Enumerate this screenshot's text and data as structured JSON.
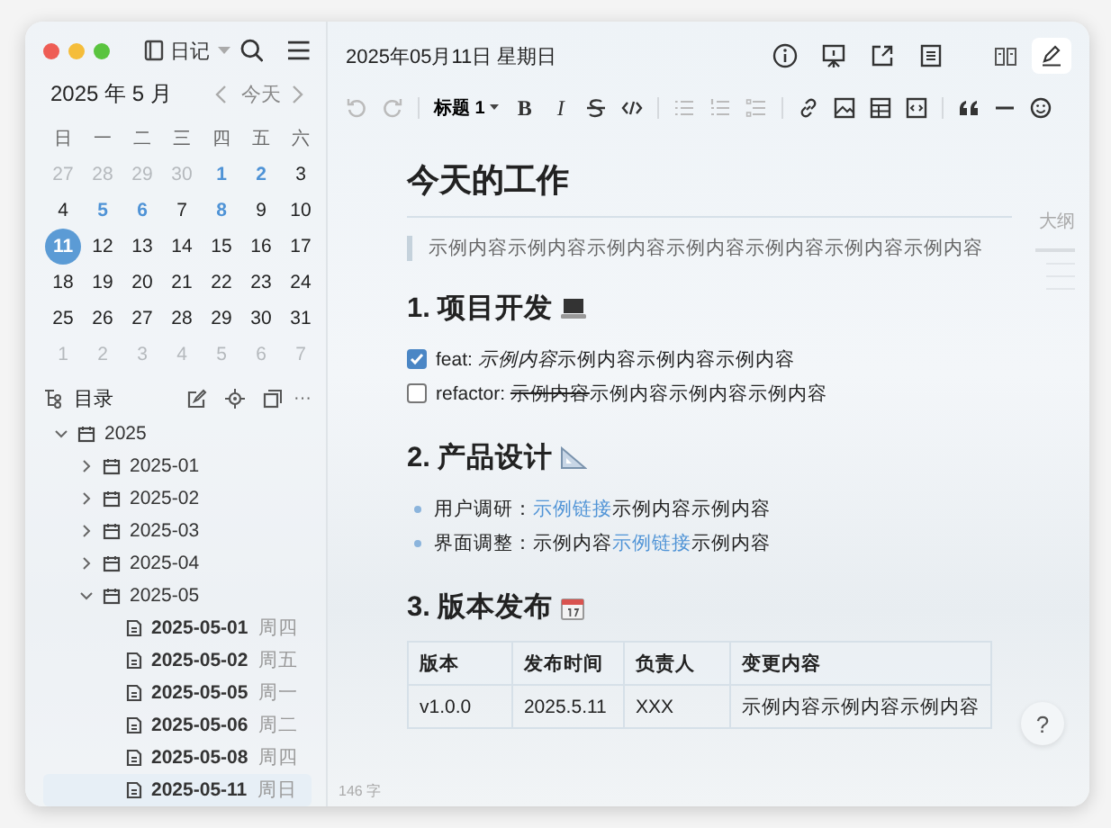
{
  "sidebar": {
    "notebook": "日记",
    "calendar": {
      "title": "2025 年 5 月",
      "today_button": "今天",
      "weekdays": [
        "日",
        "一",
        "二",
        "三",
        "四",
        "五",
        "六"
      ],
      "days": [
        {
          "label": "27",
          "kind": "other",
          "selected": false
        },
        {
          "label": "28",
          "kind": "other",
          "selected": false
        },
        {
          "label": "29",
          "kind": "other",
          "selected": false
        },
        {
          "label": "30",
          "kind": "other",
          "selected": false
        },
        {
          "label": "1",
          "kind": "entry",
          "selected": false
        },
        {
          "label": "2",
          "kind": "entry",
          "selected": false
        },
        {
          "label": "3",
          "kind": "normal",
          "selected": false
        },
        {
          "label": "4",
          "kind": "normal",
          "selected": false
        },
        {
          "label": "5",
          "kind": "entry",
          "selected": false
        },
        {
          "label": "6",
          "kind": "entry",
          "selected": false
        },
        {
          "label": "7",
          "kind": "normal",
          "selected": false
        },
        {
          "label": "8",
          "kind": "entry",
          "selected": false
        },
        {
          "label": "9",
          "kind": "normal",
          "selected": false
        },
        {
          "label": "10",
          "kind": "normal",
          "selected": false
        },
        {
          "label": "11",
          "kind": "entry",
          "selected": true
        },
        {
          "label": "12",
          "kind": "normal",
          "selected": false
        },
        {
          "label": "13",
          "kind": "normal",
          "selected": false
        },
        {
          "label": "14",
          "kind": "normal",
          "selected": false
        },
        {
          "label": "15",
          "kind": "normal",
          "selected": false
        },
        {
          "label": "16",
          "kind": "normal",
          "selected": false
        },
        {
          "label": "17",
          "kind": "normal",
          "selected": false
        },
        {
          "label": "18",
          "kind": "normal",
          "selected": false
        },
        {
          "label": "19",
          "kind": "normal",
          "selected": false
        },
        {
          "label": "20",
          "kind": "normal",
          "selected": false
        },
        {
          "label": "21",
          "kind": "normal",
          "selected": false
        },
        {
          "label": "22",
          "kind": "normal",
          "selected": false
        },
        {
          "label": "23",
          "kind": "normal",
          "selected": false
        },
        {
          "label": "24",
          "kind": "normal",
          "selected": false
        },
        {
          "label": "25",
          "kind": "normal",
          "selected": false
        },
        {
          "label": "26",
          "kind": "normal",
          "selected": false
        },
        {
          "label": "27",
          "kind": "normal",
          "selected": false
        },
        {
          "label": "28",
          "kind": "normal",
          "selected": false
        },
        {
          "label": "29",
          "kind": "normal",
          "selected": false
        },
        {
          "label": "30",
          "kind": "normal",
          "selected": false
        },
        {
          "label": "31",
          "kind": "normal",
          "selected": false
        },
        {
          "label": "1",
          "kind": "other",
          "selected": false
        },
        {
          "label": "2",
          "kind": "other",
          "selected": false
        },
        {
          "label": "3",
          "kind": "other",
          "selected": false
        },
        {
          "label": "4",
          "kind": "other",
          "selected": false
        },
        {
          "label": "5",
          "kind": "other",
          "selected": false
        },
        {
          "label": "6",
          "kind": "other",
          "selected": false
        },
        {
          "label": "7",
          "kind": "other",
          "selected": false
        }
      ]
    },
    "directory": {
      "title": "目录",
      "more": "···",
      "tree": [
        {
          "label": "2025",
          "expanded": true,
          "children": [
            {
              "label": "2025-01",
              "expanded": false
            },
            {
              "label": "2025-02",
              "expanded": false
            },
            {
              "label": "2025-03",
              "expanded": false
            },
            {
              "label": "2025-04",
              "expanded": false
            },
            {
              "label": "2025-05",
              "expanded": true,
              "children": [
                {
                  "label": "2025-05-01",
                  "weekday": "周四",
                  "selected": false
                },
                {
                  "label": "2025-05-02",
                  "weekday": "周五",
                  "selected": false
                },
                {
                  "label": "2025-05-05",
                  "weekday": "周一",
                  "selected": false
                },
                {
                  "label": "2025-05-06",
                  "weekday": "周二",
                  "selected": false
                },
                {
                  "label": "2025-05-08",
                  "weekday": "周四",
                  "selected": false
                },
                {
                  "label": "2025-05-11",
                  "weekday": "周日",
                  "selected": true
                }
              ]
            }
          ]
        }
      ]
    }
  },
  "header": {
    "date": "2025年05月11日 星期日",
    "modes": [
      {
        "selected": false
      },
      {
        "selected": true
      }
    ]
  },
  "toolbar": {
    "history_disabled": true,
    "heading": "标题 1",
    "bold": "B",
    "italic": "I",
    "lists_disabled": true
  },
  "document": {
    "title": "今天的工作",
    "quote": "示例内容示例内容示例内容示例内容示例内容示例内容示例内容",
    "sections": [
      {
        "heading": "1. 项目开发",
        "kind": "tasks",
        "items": [
          {
            "checked": true,
            "label": "feat:",
            "segments": [
              {
                "text": "示例内容",
                "kind": "italic"
              },
              {
                "text": "示例内容示例内容示例内容",
                "kind": "plain"
              }
            ]
          },
          {
            "checked": false,
            "label": "refactor:",
            "segments": [
              {
                "text": "示例内容",
                "kind": "strike"
              },
              {
                "text": "示例内容示例内容示例内容",
                "kind": "plain"
              }
            ]
          }
        ]
      },
      {
        "heading": "2. 产品设计",
        "kind": "bullets",
        "items": [
          {
            "label": "用户调研：",
            "segments": [
              {
                "text": "示例链接",
                "kind": "link"
              },
              {
                "text": "示例内容示例内容",
                "kind": "plain"
              }
            ]
          },
          {
            "label": "界面调整：",
            "segments": [
              {
                "text": "示例内容",
                "kind": "plain"
              },
              {
                "text": "示例链接",
                "kind": "link"
              },
              {
                "text": "示例内容",
                "kind": "plain"
              }
            ]
          }
        ]
      },
      {
        "heading": "3. 版本发布",
        "kind": "table",
        "columns": [
          "版本",
          "发布时间",
          "负责人",
          "变更内容"
        ],
        "rows": [
          [
            "v1.0.0",
            "2025.5.11",
            "XXX",
            "示例内容示例内容示例内容"
          ]
        ]
      }
    ]
  },
  "outline": {
    "title": "大纲"
  },
  "word_count": "146 字",
  "help_button": "?"
}
